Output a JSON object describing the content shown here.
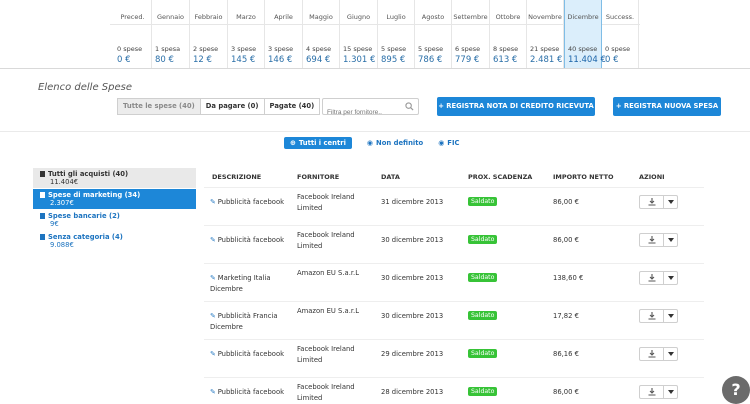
{
  "months": [
    {
      "name": "Preced.",
      "count": "0 spese",
      "value": "0 €"
    },
    {
      "name": "Gennaio",
      "count": "1 spesa",
      "value": "80 €"
    },
    {
      "name": "Febbraio",
      "count": "2 spese",
      "value": "12 €"
    },
    {
      "name": "Marzo",
      "count": "3 spese",
      "value": "145 €"
    },
    {
      "name": "Aprile",
      "count": "3 spese",
      "value": "146 €"
    },
    {
      "name": "Maggio",
      "count": "4 spese",
      "value": "694 €"
    },
    {
      "name": "Giugno",
      "count": "15 spese",
      "value": "1.301 €"
    },
    {
      "name": "Luglio",
      "count": "5 spese",
      "value": "895 €"
    },
    {
      "name": "Agosto",
      "count": "5 spese",
      "value": "786 €"
    },
    {
      "name": "Settembre",
      "count": "6 spese",
      "value": "779 €"
    },
    {
      "name": "Ottobre",
      "count": "8 spese",
      "value": "613 €"
    },
    {
      "name": "Novembre",
      "count": "21 spese",
      "value": "2.481 €"
    },
    {
      "name": "Dicembre",
      "count": "40 spese",
      "value": "11.404 €",
      "active": true
    },
    {
      "name": "Success.",
      "count": "0 spese",
      "value": "0 €"
    }
  ],
  "section_title": "Elenco delle Spese",
  "filters": {
    "all": "Tutte le spese (40)",
    "unpaid": "Da pagare (0)",
    "paid": "Pagate (40)"
  },
  "search": {
    "placeholder": "Filtra per fornitore.."
  },
  "buttons": {
    "credit_note": "+ REGISTRA NOTA DI CREDITO RICEVUTA",
    "new_expense": "+ REGISTRA NUOVA SPESA"
  },
  "centers": {
    "all": "Tutti i centri",
    "undefined": "Non definito",
    "fic": "FIC"
  },
  "sidebar": [
    {
      "title": "Tutti gli acquisti (40)",
      "value": "11.404€"
    },
    {
      "title": "Spese di marketing (34)",
      "value": "2.307€"
    },
    {
      "title": "Spese bancarie (2)",
      "value": "9€"
    },
    {
      "title": "Senza categoria (4)",
      "value": "9.088€"
    }
  ],
  "table": {
    "headers": [
      "DESCRIZIONE",
      "FORNITORE",
      "DATA",
      "PROX. SCADENZA",
      "IMPORTO NETTO",
      "AZIONI"
    ],
    "rows": [
      {
        "desc": "Pubblicità facebook",
        "supplier": "Facebook Ireland Limited",
        "date": "31 dicembre 2013",
        "status": "Saldato",
        "amount": "86,00 €"
      },
      {
        "desc": "Pubblicità facebook",
        "supplier": "Facebook Ireland Limited",
        "date": "30 dicembre 2013",
        "status": "Saldato",
        "amount": "86,00 €"
      },
      {
        "desc": "Marketing Italia Dicembre",
        "supplier": "Amazon EU S.a.r.L",
        "date": "30 dicembre 2013",
        "status": "Saldato",
        "amount": "138,60 €"
      },
      {
        "desc": "Pubblicità Francia Dicembre",
        "supplier": "Amazon EU S.a.r.L",
        "date": "30 dicembre 2013",
        "status": "Saldato",
        "amount": "17,82 €"
      },
      {
        "desc": "Pubblicità facebook",
        "supplier": "Facebook Ireland Limited",
        "date": "29 dicembre 2013",
        "status": "Saldato",
        "amount": "86,16 €"
      },
      {
        "desc": "Pubblicità facebook",
        "supplier": "Facebook Ireland Limited",
        "date": "28 dicembre 2013",
        "status": "Saldato",
        "amount": "86,00 €"
      }
    ]
  },
  "help": "?",
  "colors": {
    "accent": "#1d87d8",
    "status_paid": "#37c337",
    "active_month": "#dbeefb"
  },
  "icons": {
    "search": "search-icon",
    "download": "download-icon",
    "caret": "caret-down-icon",
    "tag": "tag-icon",
    "doc": "document-icon"
  }
}
